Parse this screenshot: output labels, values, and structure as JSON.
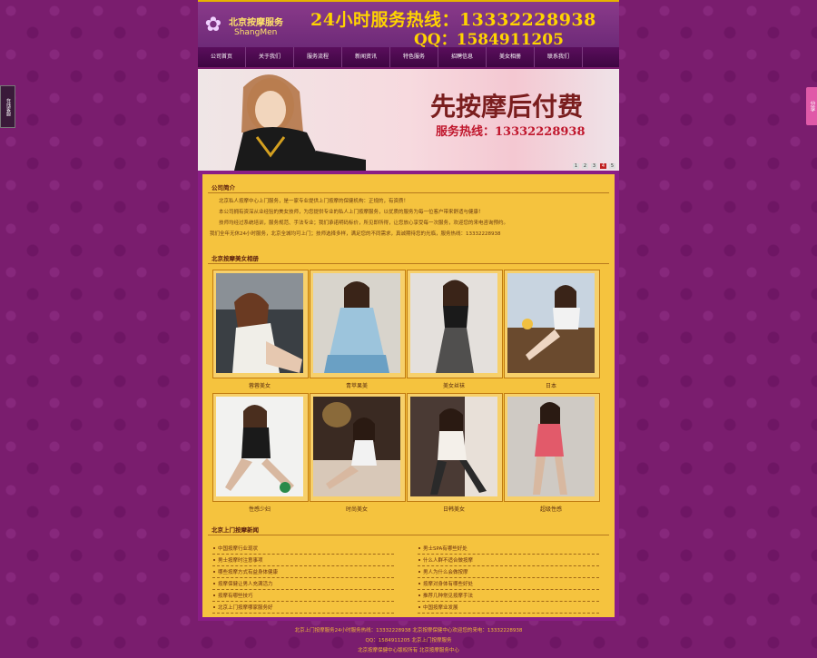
{
  "header": {
    "logo_cn": "北京按摩服务",
    "logo_en": "ShangMen",
    "hotline": "24小时服务热线：13332228938",
    "qq": "QQ：1584911205"
  },
  "nav": [
    "公司首页",
    "关于我们",
    "服务流程",
    "新闻资讯",
    "特色服务",
    "招聘信息",
    "美女相册",
    "联系我们"
  ],
  "banner": {
    "title": "先按摩后付费",
    "subtitle": "服务热线：13332228938",
    "dots": [
      "1",
      "2",
      "3",
      "4",
      "5"
    ]
  },
  "intro": {
    "title": "公司简介",
    "lines": [
      "北京私人按摩中心上门服务，是一家专业提供上门按摩的保健机构：正规的，有资质！",
      "本公司拥有资深从业经验的美女技师，为您提供专业的私人上门按摩服务，以优质的服务为每一位客户带来舒适与健康！",
      "技师均经过系统培训，服务规范、手法专业；我们承诺明码标价，所见即所得，让您放心享受每一次服务，欢迎您的来电咨询预约。",
      "我们全年无休24小时服务，北京全城均可上门；技师选择多样，满足您的不同需求，真诚期待您的光临，服务热线：13332228938"
    ]
  },
  "gallery": {
    "title": "北京按摩美女相册",
    "captions": [
      "蓉蓉美女",
      "青苹果美",
      "美女丝袜",
      "日本",
      "性感少妇",
      "时尚美女",
      "日韩美女",
      "超级性感"
    ]
  },
  "news": {
    "title": "北京上门按摩新闻",
    "left": [
      "中国按摩行业现状",
      "男士按摩时注意事项",
      "哪些按摩方式有益身体健康",
      "按摩保健让男人充满活力",
      "按摩有哪些技巧",
      "北京上门按摩哪家服务好"
    ],
    "right": [
      "男士SPA有哪些好处",
      "什么人群不适合做按摩",
      "男人为什么会做按摩",
      "按摩对身体有哪些好处",
      "推荐几种常见按摩手法",
      "中国按摩业发展"
    ]
  },
  "footer": {
    "line1": "北京上门按摩服务24小时服务热线：13332228938  北京按摩保健中心欢迎您的来电：13332228938",
    "line2": "QQ：1584911205  北京上门按摩服务",
    "line3": "北京按摩保健中心版权所有  北京按摩服务中心"
  },
  "floats": {
    "left": "在线客服",
    "right": "分享"
  }
}
